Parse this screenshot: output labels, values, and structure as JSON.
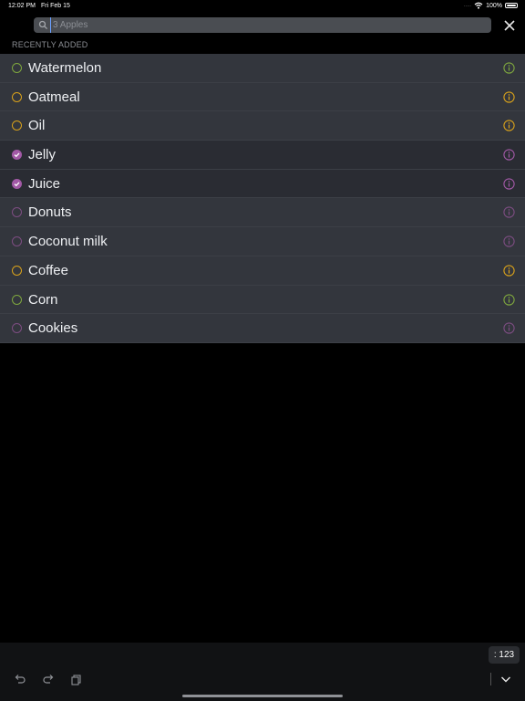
{
  "status": {
    "time": "12:02 PM",
    "date": "Fri Feb 15",
    "battery": "100%",
    "dots": "....."
  },
  "search": {
    "value": "",
    "placeholder": "3 Apples"
  },
  "section": {
    "title": "RECENTLY ADDED"
  },
  "items": [
    {
      "label": "Watermelon",
      "checked": false,
      "color": "#7ea63e"
    },
    {
      "label": "Oatmeal",
      "checked": false,
      "color": "#d9a21b"
    },
    {
      "label": "Oil",
      "checked": false,
      "color": "#d9a21b"
    },
    {
      "label": "Jelly",
      "checked": true,
      "color": "#a259a6"
    },
    {
      "label": "Juice",
      "checked": true,
      "color": "#a259a6"
    },
    {
      "label": "Donuts",
      "checked": false,
      "color": "#7d4d82"
    },
    {
      "label": "Coconut milk",
      "checked": false,
      "color": "#7d4d82"
    },
    {
      "label": "Coffee",
      "checked": false,
      "color": "#d9a21b"
    },
    {
      "label": "Corn",
      "checked": false,
      "color": "#7ea63e"
    },
    {
      "label": "Cookies",
      "checked": false,
      "color": "#7d4d82"
    }
  ],
  "keyboard": {
    "numbers_label": ": 123"
  }
}
